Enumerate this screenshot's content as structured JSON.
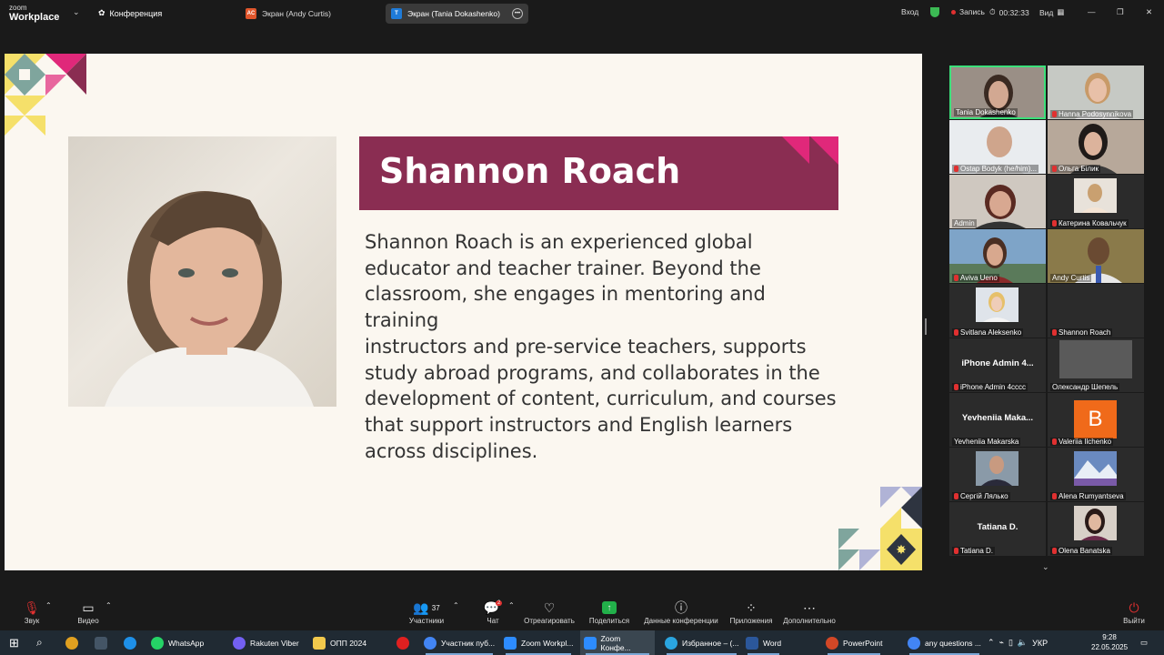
{
  "topbar": {
    "logo_line1": "zoom",
    "logo_line2": "Workplace",
    "conference_label": "Конференция",
    "tabs": [
      {
        "badge": "AC",
        "label": "Экран (Andy Curtis)",
        "badge_color": "#e0562c"
      },
      {
        "badge": "T",
        "label": "Экран (Tania Dokashenko)",
        "badge_color": "#1f7bd8"
      }
    ],
    "login": "Вход",
    "recording": "Запись",
    "timer": "00:32:33",
    "view": "Вид"
  },
  "slide": {
    "name": "Shannon Roach",
    "bio_lines": [
      "Shannon Roach is an experienced global",
      "educator and teacher trainer. Beyond the",
      "classroom, she engages in mentoring and training",
      "instructors and pre-service teachers, supports",
      "study abroad programs, and collaborates in the",
      "development of content, curriculum, and courses",
      "that support instructors and English learners",
      "across disciplines."
    ],
    "banner_color": "#8a2d52",
    "accent_pink": "#e0287a",
    "accent_yellow": "#f5e06a",
    "accent_teal": "#7fa59d",
    "accent_navy": "#2e3440",
    "accent_lavender": "#b0b3d6"
  },
  "participants": [
    {
      "name": "Tania Dokashenko",
      "type": "video",
      "muted": false,
      "active": true
    },
    {
      "name": "Hanna Podosynnikova",
      "type": "video",
      "muted": true
    },
    {
      "name": "Ostap Bodyk (he/him)...",
      "type": "video",
      "muted": true
    },
    {
      "name": "Ольга Білик",
      "type": "video",
      "muted": true
    },
    {
      "name": "Admin",
      "type": "video",
      "muted": false
    },
    {
      "name": "Катерина Ковальчук",
      "type": "avatar",
      "muted": true
    },
    {
      "name": "Aviva Ueno",
      "type": "video",
      "muted": true
    },
    {
      "name": "Andy Curtis",
      "type": "video",
      "muted": false
    },
    {
      "name": "Svitlana Aleksenko",
      "type": "avatar",
      "muted": true
    },
    {
      "name": "Shannon Roach",
      "type": "blank",
      "muted": true
    },
    {
      "name": "iPhone Admin 4cccc",
      "type": "text",
      "big": "iPhone Admin 4...",
      "muted": true
    },
    {
      "name": "Олександр Шепель",
      "type": "avatar",
      "muted": false
    },
    {
      "name": "Yevheniia Makarska",
      "type": "text",
      "big": "Yevheniia Maka...",
      "muted": false
    },
    {
      "name": "Valeriia Ilchenko",
      "type": "letter",
      "letter": "B",
      "muted": true
    },
    {
      "name": "Сергій Лялько",
      "type": "avatar",
      "muted": true
    },
    {
      "name": "Alena Rumyantseva",
      "type": "avatar",
      "muted": true
    },
    {
      "name": "Tatiana D.",
      "type": "text",
      "big": "Tatiana D.",
      "muted": true
    },
    {
      "name": "Olena Banatska",
      "type": "avatar",
      "muted": true
    }
  ],
  "controls": {
    "sound": "Звук",
    "video": "Видео",
    "participants": "Участники",
    "participants_count": "37",
    "chat": "Чат",
    "chat_badge": "2",
    "react": "Отреагировать",
    "share": "Поделиться",
    "conf_data": "Данные конференции",
    "apps": "Приложения",
    "more": "Дополнительно",
    "leave": "Выйти"
  },
  "taskbar": {
    "items": [
      {
        "label": "WhatsApp",
        "color": "#25d366"
      },
      {
        "label": "Rakuten Viber",
        "color": "#7360f2"
      },
      {
        "label": "ОПП 2024",
        "color": "#f2c94c"
      },
      {
        "label": "",
        "color": "#e02020"
      },
      {
        "label": "Участник пуб...",
        "color": "#4285f4"
      },
      {
        "label": "Zoom Workpl...",
        "color": "#2d8cff"
      },
      {
        "label": "Zoom Конфе...",
        "color": "#2d8cff"
      },
      {
        "label": "Избранное – (...",
        "color": "#2aa5e0"
      },
      {
        "label": "Word",
        "color": "#2b579a"
      },
      {
        "label": "PowerPoint",
        "color": "#d24726"
      },
      {
        "label": "any questions ...",
        "color": "#4285f4"
      }
    ],
    "lang": "УКР",
    "time": "9:28",
    "date": "22.05.2025"
  }
}
